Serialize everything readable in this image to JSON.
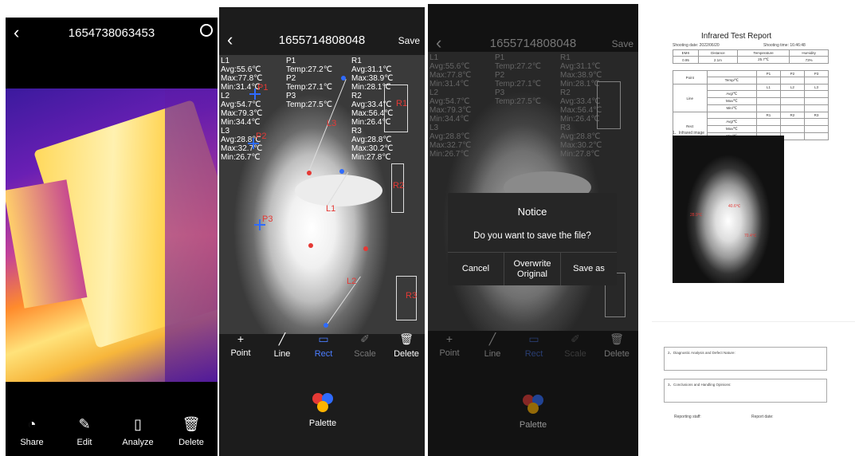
{
  "panel1": {
    "title": "1654738063453",
    "actions": [
      {
        "label": "Share",
        "icon": "share-icon"
      },
      {
        "label": "Edit",
        "icon": "pencil-icon"
      },
      {
        "label": "Analyze",
        "icon": "clipboard-icon"
      },
      {
        "label": "Delete",
        "icon": "trash-icon"
      }
    ]
  },
  "panel2": {
    "title": "1655714808048",
    "save_label": "Save",
    "readings": {
      "col1": "L1\nAvg:55.6℃\nMax:77.8℃\nMin:31.4℃\nL2\nAvg:54.7℃\nMax:79.3℃\nMin:34.4℃\nL3\nAvg:28.8℃\nMax:32.7℃\nMin:26.7℃",
      "col2": "P1\nTemp:27.2℃\nP2\nTemp:27.1℃\nP3\nTemp:27.5℃",
      "col3": "R1\nAvg:31.1℃\nMax:38.9℃\nMin:28.1℃\nR2\nAvg:33.4℃\nMax:56.4℃\nMin:26.4℃\nR3\nAvg:28.8℃\nMax:30.2℃\nMin:27.8℃"
    },
    "markers": {
      "p1": "P1",
      "p2": "P2",
      "p3": "P3",
      "l1": "L1",
      "l2": "L2",
      "l3": "L3",
      "r1": "R1",
      "r2": "R2",
      "r3": "R3"
    },
    "tools": [
      {
        "label": "Point",
        "icon": "point-icon",
        "state": "normal"
      },
      {
        "label": "Line",
        "icon": "line-icon",
        "state": "normal"
      },
      {
        "label": "Rect",
        "icon": "rect-icon",
        "state": "active"
      },
      {
        "label": "Scale",
        "icon": "ruler-icon",
        "state": "disabled"
      },
      {
        "label": "Delete",
        "icon": "trash-icon",
        "state": "normal"
      }
    ],
    "palette_label": "Palette"
  },
  "panel3": {
    "title": "1655714808048",
    "save_label": "Save",
    "dialog": {
      "title": "Notice",
      "message": "Do you want to save the file?",
      "cancel": "Cancel",
      "overwrite": "Overwrite\nOriginal",
      "save_as": "Save as"
    },
    "palette_label": "Palette"
  },
  "report": {
    "title": "Infrared Test Report",
    "shooting_date_label": "Shooting date: 2022/06/20",
    "shooting_time_label": "Shooting time: 16:46:48",
    "summary_headers": [
      "EMS",
      "Distance",
      "Temperature",
      "Humidity"
    ],
    "summary_values": [
      "0.95",
      "2.1m",
      "25.7℃",
      "73%"
    ],
    "point_headers": [
      "P1",
      "P2",
      "P3"
    ],
    "line_headers": [
      "L1",
      "L2",
      "L3"
    ],
    "rect_headers": [
      "R1",
      "R2",
      "R3"
    ],
    "row_labels": {
      "point": "Point",
      "line": "Line",
      "rect": "Rect",
      "temp": "Temp/℃",
      "avg": "Avg/℃",
      "max": "Max/℃",
      "min": "Min/℃"
    },
    "image_label": "1、Infrared image",
    "thumb_labels": {
      "a": "28.9℃",
      "b": "40.6℃",
      "c": "70.4℃"
    },
    "box1": "2、Diagnostic Analysis and Defect Nature:",
    "box2": "3、Conclusions and Handling Opinions:",
    "reporter": "Reporting staff:",
    "report_date": "Report date:"
  },
  "colors": {
    "accent": "#4b7dff",
    "marker_red": "#e53935",
    "marker_blue": "#2f6bff"
  }
}
